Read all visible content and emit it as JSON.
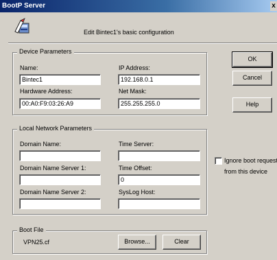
{
  "window": {
    "title": "BootP Server",
    "close_glyph": "x"
  },
  "header": {
    "description": "Edit Bintec1's basic configuration",
    "icon": "server-config-icon"
  },
  "device_parameters": {
    "legend": "Device Parameters",
    "name": {
      "label": "Name:",
      "value": "Bintec1"
    },
    "ip_address": {
      "label": "IP Address:",
      "value": "192.168.0.1"
    },
    "hardware_address": {
      "label": "Hardware Address:",
      "value": "00:A0:F9:03:26:A9"
    },
    "net_mask": {
      "label": "Net Mask:",
      "value": "255.255.255.0"
    }
  },
  "local_network": {
    "legend": "Local Network Parameters",
    "domain_name": {
      "label": "Domain Name:",
      "value": ""
    },
    "time_server": {
      "label": "Time Server:",
      "value": ""
    },
    "dns1": {
      "label": "Domain Name Server 1:",
      "value": ""
    },
    "time_offset": {
      "label": "Time Offset:",
      "value": "0"
    },
    "dns2": {
      "label": "Domain Name Server 2:",
      "value": ""
    },
    "syslog_host": {
      "label": "SysLog Host:",
      "value": ""
    }
  },
  "boot_file": {
    "legend": "Boot File",
    "value": "VPN25.cf",
    "browse_label": "Browse...",
    "clear_label": "Clear"
  },
  "buttons": {
    "ok": "OK",
    "cancel": "Cancel",
    "help": "Help"
  },
  "ignore_boot": {
    "label": "Ignore boot request",
    "label2": "from this device",
    "checked": false
  }
}
